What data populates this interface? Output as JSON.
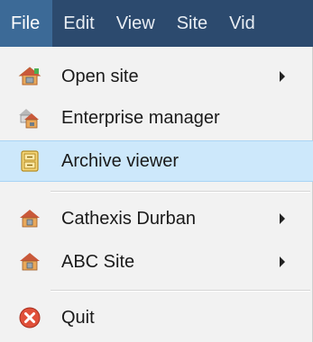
{
  "menubar": {
    "items": [
      {
        "label": "File",
        "active": true
      },
      {
        "label": "Edit"
      },
      {
        "label": "View"
      },
      {
        "label": "Site"
      },
      {
        "label": "Vid"
      }
    ]
  },
  "file_menu": {
    "items": [
      {
        "label": "Open site",
        "icon": "house-green-icon",
        "submenu": true
      },
      {
        "label": "Enterprise manager",
        "icon": "house-group-icon",
        "submenu": false
      },
      {
        "label": "Archive viewer",
        "icon": "archive-cabinet-icon",
        "submenu": false,
        "highlighted": true
      },
      {
        "label": "Cathexis Durban",
        "icon": "house-icon",
        "submenu": true
      },
      {
        "label": "ABC Site",
        "icon": "house-icon",
        "submenu": true
      },
      {
        "label": "Quit",
        "icon": "quit-icon",
        "submenu": false
      }
    ]
  },
  "colors": {
    "menubar_bg": "#2c4a6e",
    "menubar_active": "#3c6a97",
    "highlight_bg": "#cde8fb",
    "menu_bg": "#f2f2f2"
  }
}
